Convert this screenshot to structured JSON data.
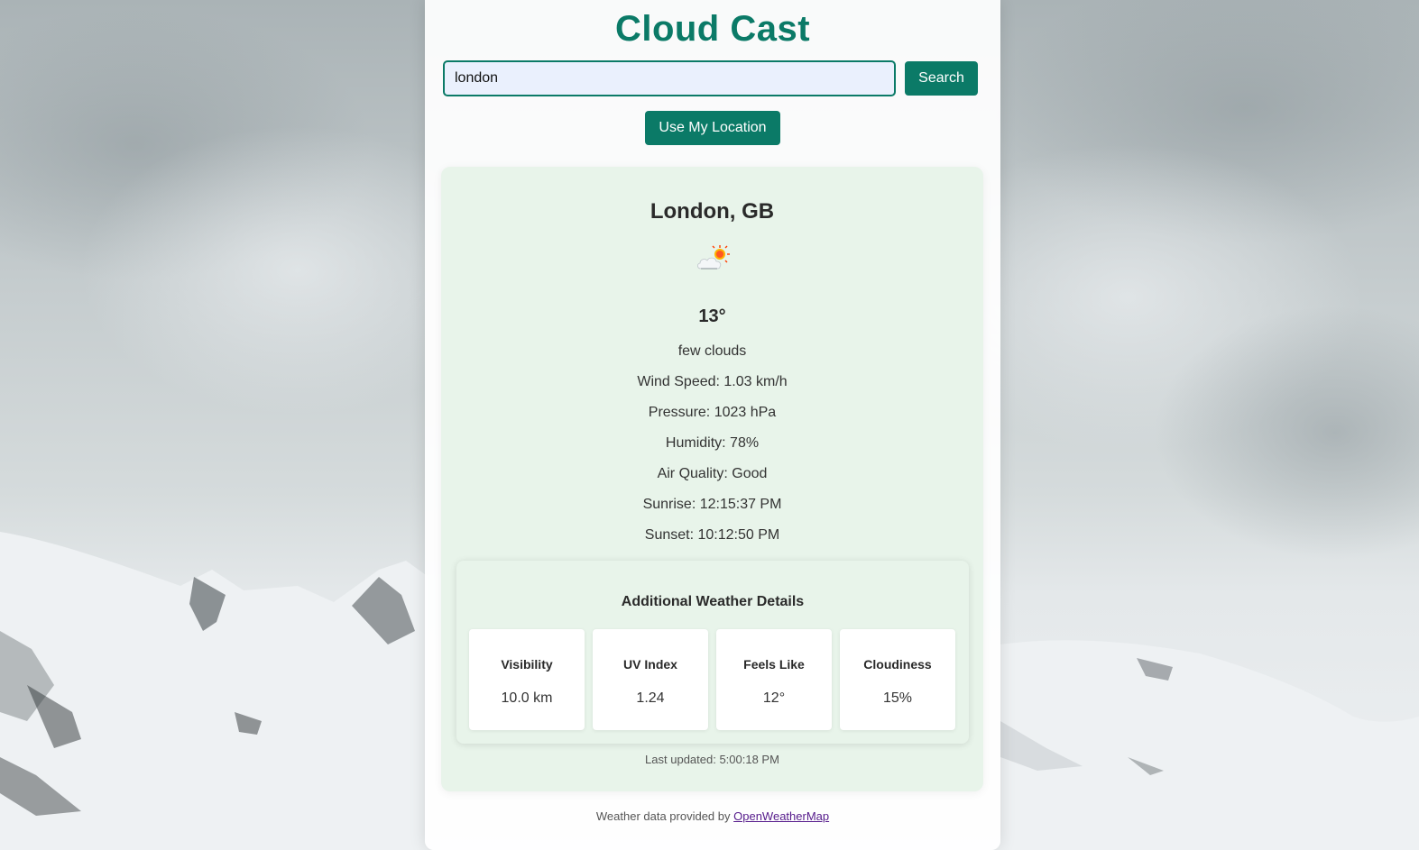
{
  "app": {
    "title": "Cloud Cast"
  },
  "search": {
    "value": "london",
    "button_label": "Search"
  },
  "location_button_label": "Use My Location",
  "weather": {
    "city": "London, GB",
    "icon": "cloud-sun-icon",
    "temperature": "13°",
    "description": "few clouds",
    "wind": "Wind Speed: 1.03 km/h",
    "pressure": "Pressure: 1023 hPa",
    "humidity": "Humidity: 78%",
    "air_quality": "Air Quality: Good",
    "sunrise": "Sunrise: 12:15:37 PM",
    "sunset": "Sunset: 10:12:50 PM"
  },
  "details": {
    "title": "Additional Weather Details",
    "tiles": [
      {
        "label": "Visibility",
        "value": "10.0 km"
      },
      {
        "label": "UV Index",
        "value": "1.24"
      },
      {
        "label": "Feels Like",
        "value": "12°"
      },
      {
        "label": "Cloudiness",
        "value": "15%"
      }
    ]
  },
  "last_updated": "Last updated: 5:00:18 PM",
  "footer": {
    "text": "Weather data provided by ",
    "link_label": "OpenWeatherMap"
  },
  "colors": {
    "accent": "#0b7a67",
    "card_bg": "#e8f4ea",
    "input_bg": "#eaf0fd"
  }
}
